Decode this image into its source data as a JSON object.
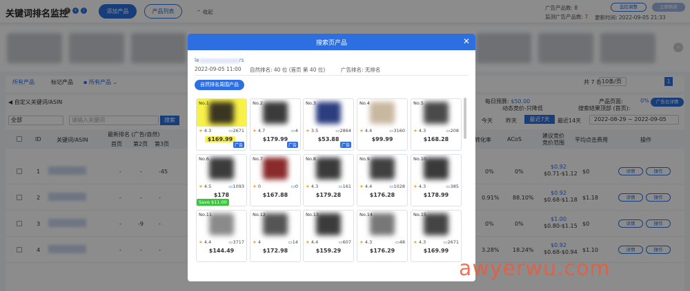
{
  "header": {
    "title": "关键词排名监控",
    "add_product": "添加产品",
    "product_list": "产品列表",
    "collapse": "收起",
    "ad_products_label": "广告产品数: 8",
    "monitored_ads_label": "监测广告产品数:",
    "monitored_ads_count": "7",
    "update_time": "更新时间: 2022-09-05 21:33",
    "monitor_settings": "监控调整",
    "refresh_btn": "立即刷新"
  },
  "subbar": {
    "tab_all": "所有产品",
    "tab_marked": "标记产品",
    "folder": "所有产品",
    "total": "共 7 条",
    "page_size": "10条/页",
    "page": "1"
  },
  "toolbar": {
    "custom_kw": "自定义关键词/ASIN",
    "filter_all": "全部",
    "search_placeholder": "请输入关键词",
    "search_btn": "搜索",
    "today": "今天",
    "yesterday": "昨天",
    "last7": "最近7天",
    "last14": "最近14天",
    "date_range": "2022-08-29 ~ 2022-09-05",
    "daily_budget": "每日预算:",
    "budget_value": "$50.00",
    "bidding": "动态竞价-只降低",
    "product_page": "产品页面:",
    "search_top": "搜索结果顶部 (首页):",
    "pct0": "0%",
    "ad_group_btn": "广告位详情"
  },
  "table": {
    "headers": [
      "ID",
      "关键词/ASIN",
      "最新排名 (广告/自然)",
      "首页",
      "第2页",
      "第3页",
      "转化率",
      "ACoS",
      "建议竞价",
      "竞价范围",
      "平均点击费用",
      "操作"
    ],
    "rows": [
      {
        "id": "1",
        "p1": "-",
        "p2": "-",
        "p3": "-45",
        "cvr": "0%",
        "acos": "0%",
        "bid": "$0.92",
        "range": "$0.71-$1.12",
        "cpc": "$0"
      },
      {
        "id": "2",
        "p1": "-",
        "p2": "-",
        "p3": "-",
        "cvr": "0.91%",
        "acos": "88.10%",
        "bid": "$0.92",
        "range": "$0.68-$1.18",
        "cpc": "$1.18"
      },
      {
        "id": "3",
        "p1": "-",
        "p2": "-9",
        "p3": "-",
        "cvr": "0%",
        "acos": "0%",
        "bid": "$1.00",
        "range": "$0.80-$1.15",
        "cpc": "$0"
      },
      {
        "id": "4",
        "p1": "-",
        "p2": "-",
        "p3": "-",
        "cvr": "3.28%",
        "acos": "18.24%",
        "bid": "$0.92",
        "range": "$0.68-$0.94",
        "cpc": "$1.10"
      }
    ],
    "detail_btn": "详情",
    "action_btn": "操作"
  },
  "modal": {
    "title": "搜索页产品",
    "keyword_prefix": "le",
    "keyword_suffix": "rs",
    "datetime": "2022-09-05 11:00",
    "natural_rank": "自然排名:  40 位 (首页 第 40 位)",
    "ad_rank": "广告排名:  无排名",
    "tab": "自然排名周围产品",
    "ad_tag": "广告",
    "save_badge": "Save $11.00",
    "products": [
      {
        "no": "No.1",
        "rating": "4.3",
        "reviews": "2671",
        "price": "$169.99",
        "ad": true,
        "highlight": true
      },
      {
        "no": "No.2",
        "rating": "4.7",
        "reviews": "4",
        "price": "$179.99",
        "ad": true
      },
      {
        "no": "No.3",
        "rating": "3.5",
        "reviews": "2864",
        "price": "$53.88",
        "ad": true
      },
      {
        "no": "No.4",
        "rating": "4.4",
        "reviews": "3160",
        "price": "$99.99",
        "ad": false
      },
      {
        "no": "No.5",
        "rating": "4.3",
        "reviews": "208",
        "price": "$168.28",
        "ad": false
      },
      {
        "no": "No.6",
        "rating": "4.5",
        "reviews": "1093",
        "price": "$178",
        "ad": false
      },
      {
        "no": "No.7",
        "rating": "0",
        "reviews": "0",
        "price": "$167.88",
        "ad": false
      },
      {
        "no": "No.8",
        "rating": "4.3",
        "reviews": "161",
        "price": "$179.28",
        "ad": false
      },
      {
        "no": "No.9",
        "rating": "4.4",
        "reviews": "1028",
        "price": "$176.28",
        "ad": false
      },
      {
        "no": "No.10",
        "rating": "4.3",
        "reviews": "385",
        "price": "$178.99",
        "ad": false
      },
      {
        "no": "No.11",
        "rating": "4.4",
        "reviews": "3717",
        "price": "$144.49",
        "ad": false
      },
      {
        "no": "No.12",
        "rating": "4",
        "reviews": "14",
        "price": "$172.98",
        "ad": false
      },
      {
        "no": "No.13",
        "rating": "4.4",
        "reviews": "607",
        "price": "$159.29",
        "ad": false
      },
      {
        "no": "No.14",
        "rating": "4.3",
        "reviews": "48",
        "price": "$176.29",
        "ad": false
      },
      {
        "no": "No.15",
        "rating": "4.3",
        "reviews": "2671",
        "price": "$169.99",
        "ad": false
      }
    ]
  },
  "watermark": "awyerwu.com",
  "colors": {
    "primary": "#2d6fe0",
    "highlight": "#f7f14a",
    "save": "#3fc23f",
    "watermark": "#ec5a3c"
  }
}
